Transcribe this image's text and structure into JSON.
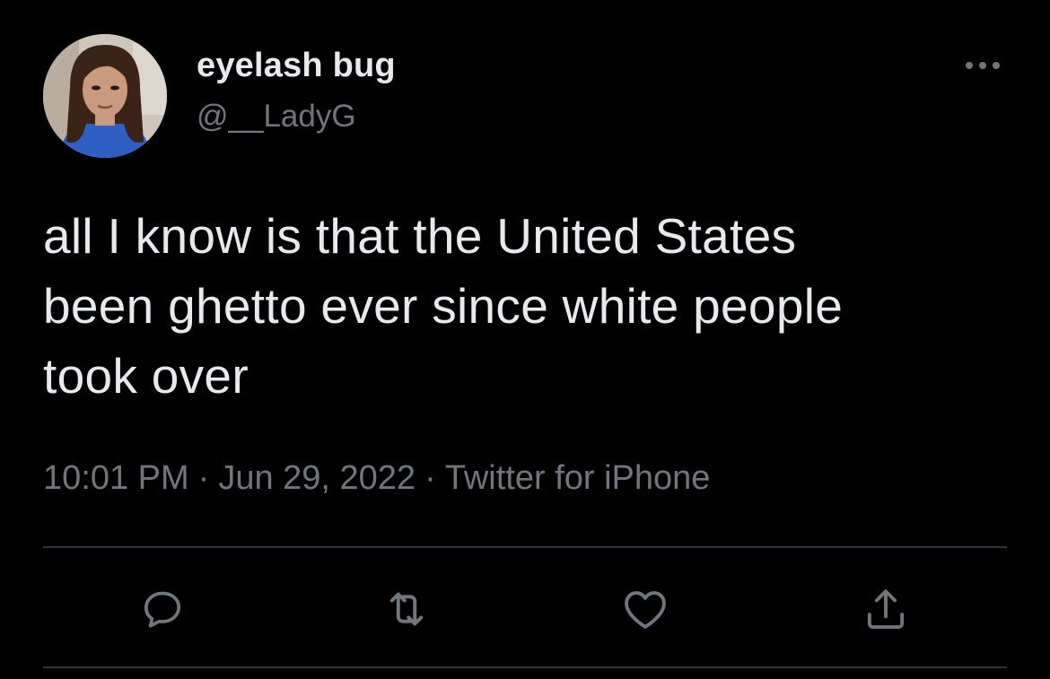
{
  "user": {
    "display_name": "eyelash bug",
    "handle": "@__LadyG"
  },
  "tweet": {
    "text_lines": [
      "all I know is that the United States",
      "been ghetto ever since white people",
      "took over"
    ],
    "time": "10:01 PM",
    "date": "Jun 29, 2022",
    "source": "Twitter for iPhone",
    "separator": "·"
  },
  "icons": {
    "more": "more-horizontal-icon",
    "reply": "reply-icon",
    "retweet": "retweet-icon",
    "like": "heart-icon",
    "share": "share-icon"
  },
  "colors": {
    "background": "#000000",
    "primary_text": "#e7e9ea",
    "secondary_text": "#71767b",
    "divider": "#2f3336"
  }
}
